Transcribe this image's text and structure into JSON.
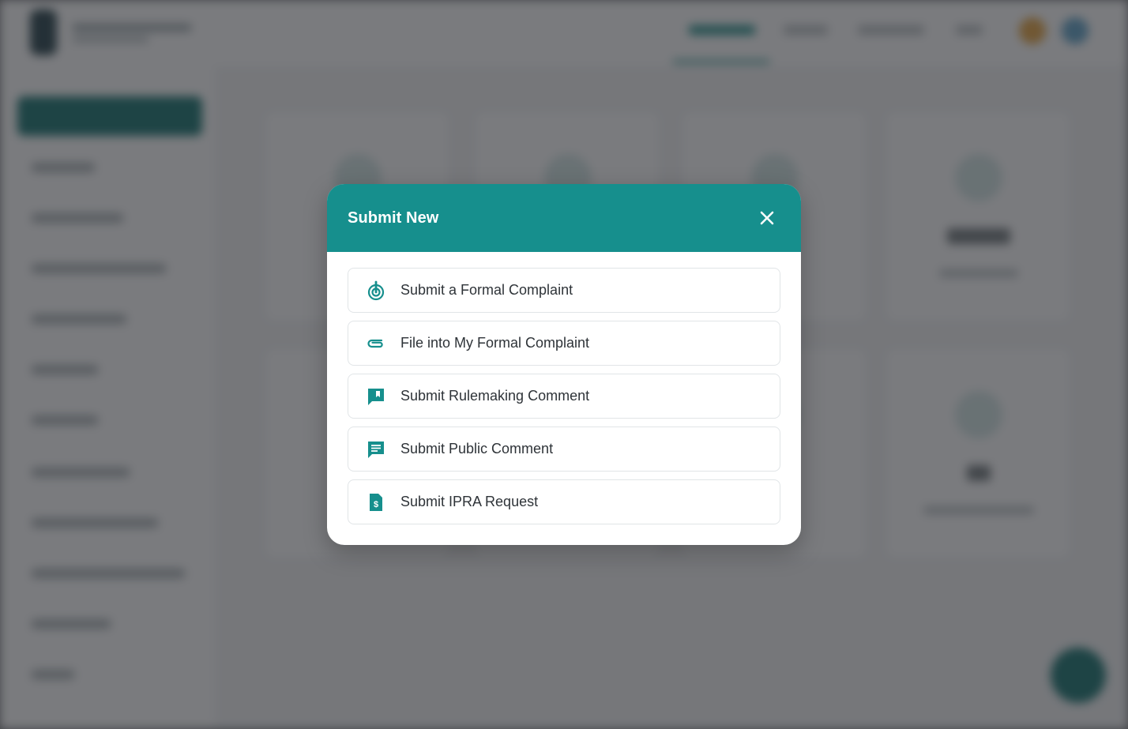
{
  "modal": {
    "title": "Submit New",
    "accent_color": "#168f8d",
    "close_icon": "close-icon",
    "options": [
      {
        "label": "Submit a Formal Complaint",
        "icon": "touch-target-icon"
      },
      {
        "label": "File into My Formal Complaint",
        "icon": "paperclip-icon"
      },
      {
        "label": "Submit Rulemaking Comment",
        "icon": "bookmark-comment-icon"
      },
      {
        "label": "Submit Public Comment",
        "icon": "comment-text-icon"
      },
      {
        "label": "Submit IPRA Request",
        "icon": "dollar-document-icon"
      }
    ]
  }
}
